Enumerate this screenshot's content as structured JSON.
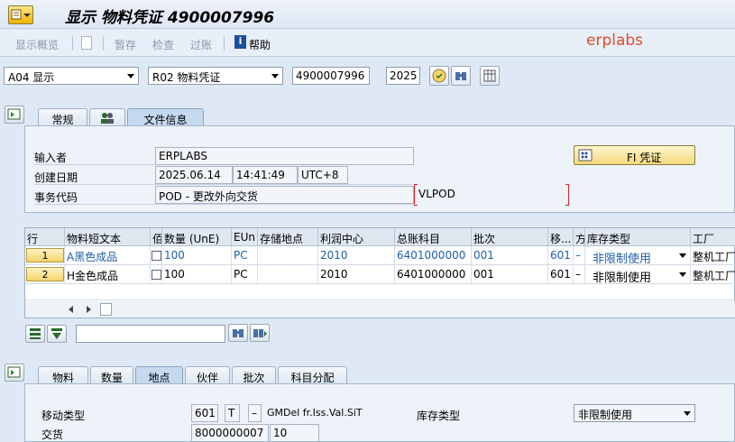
{
  "window": {
    "title": "显示 物料凭证 4900007996"
  },
  "brand": "erplabs",
  "toolbar": {
    "items": [
      "显示概览",
      "暂存",
      "检查",
      "过账",
      "帮助"
    ]
  },
  "header_fields": {
    "action": "A04 显示",
    "reference": "R02 物料凭证",
    "doc_number": "4900007996",
    "year": "2025"
  },
  "header_tabs": [
    "常规",
    "文件信息"
  ],
  "doc_info": {
    "entered_by_label": "输入者",
    "entered_by": "ERPLABS",
    "created_on_label": "创建日期",
    "date": "2025.06.14",
    "time": "14:41:49",
    "tz": "UTC+8",
    "trans_code_label": "事务代码",
    "trans_code": "POD - 更改外向交货",
    "trans_code_extra": "VLPOD",
    "fi_button": "FI 凭证"
  },
  "grid": {
    "columns": [
      "行",
      "物料短文本",
      "佰",
      "数量 (UnE)",
      "EUn",
      "存储地点",
      "利润中心",
      "总账科目",
      "批次",
      "移...",
      "方",
      "库存类型",
      "工厂"
    ],
    "rows": [
      {
        "line": "1",
        "text": "A黑色成品",
        "qty": "100",
        "eun": "PC",
        "sloc": "",
        "profit": "2010",
        "gl": "6401000000",
        "batch": "001",
        "mvt": "601",
        "dir": "–",
        "stock": "非限制使用",
        "plant": "整机工厂"
      },
      {
        "line": "2",
        "text": "H金色成品",
        "qty": "100",
        "eun": "PC",
        "sloc": "",
        "profit": "2010",
        "gl": "6401000000",
        "batch": "001",
        "mvt": "601",
        "dir": "–",
        "stock": "非限制使用",
        "plant": "整机工厂"
      }
    ]
  },
  "detail_tabs": [
    "物料",
    "数量",
    "地点",
    "伙伴",
    "批次",
    "科目分配"
  ],
  "detail": {
    "mvt_type_label": "移动类型",
    "mvt_type": "601",
    "mvt_t": "T",
    "mvt_dash": "–",
    "mvt_desc": "GMDel fr.Iss.Val.SiT",
    "stock_type_label": "库存类型",
    "stock_type": "非限制使用",
    "delivery_label": "交货",
    "delivery": "8000000007",
    "delivery_item": "10"
  },
  "colors": {
    "accent": "#f4d97c",
    "brand": "#e44a2a",
    "link": "#1d5fa8"
  }
}
